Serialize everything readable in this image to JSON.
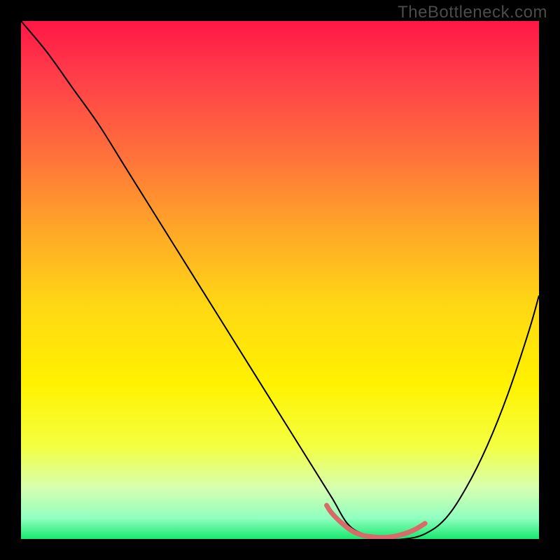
{
  "watermark": "TheBottleneck.com",
  "chart_data": {
    "type": "line",
    "title": "",
    "xlabel": "",
    "ylabel": "",
    "xlim": [
      0,
      100
    ],
    "ylim": [
      0,
      100
    ],
    "series": [
      {
        "name": "curve",
        "stroke": "#000000",
        "stroke_width": 2,
        "x": [
          0,
          5,
          10,
          15,
          20,
          25,
          30,
          35,
          40,
          45,
          50,
          55,
          60,
          63,
          66,
          70,
          74,
          78,
          82,
          86,
          90,
          94,
          98,
          100
        ],
        "y": [
          100,
          94,
          87,
          80,
          72,
          64,
          56,
          48,
          40,
          32,
          24,
          16,
          8,
          3,
          1,
          0,
          0,
          1,
          4,
          10,
          18,
          28,
          40,
          47
        ]
      },
      {
        "name": "minimum-highlight",
        "stroke": "#d96a6a",
        "stroke_width": 7,
        "x": [
          59,
          60,
          62,
          64,
          66,
          68,
          70,
          72,
          74,
          76,
          78
        ],
        "y": [
          6.5,
          5,
          3,
          1.5,
          0.7,
          0.4,
          0.3,
          0.5,
          1.0,
          1.8,
          3
        ]
      }
    ],
    "background_gradient": {
      "stops": [
        {
          "offset": 0.0,
          "color": "#ff1744"
        },
        {
          "offset": 0.1,
          "color": "#ff3b4a"
        },
        {
          "offset": 0.25,
          "color": "#ff6e3c"
        },
        {
          "offset": 0.4,
          "color": "#ffa628"
        },
        {
          "offset": 0.55,
          "color": "#ffd814"
        },
        {
          "offset": 0.7,
          "color": "#fff200"
        },
        {
          "offset": 0.82,
          "color": "#f4ff40"
        },
        {
          "offset": 0.9,
          "color": "#d8ffb0"
        },
        {
          "offset": 0.96,
          "color": "#90ffc0"
        },
        {
          "offset": 1.0,
          "color": "#18e86e"
        }
      ]
    }
  }
}
